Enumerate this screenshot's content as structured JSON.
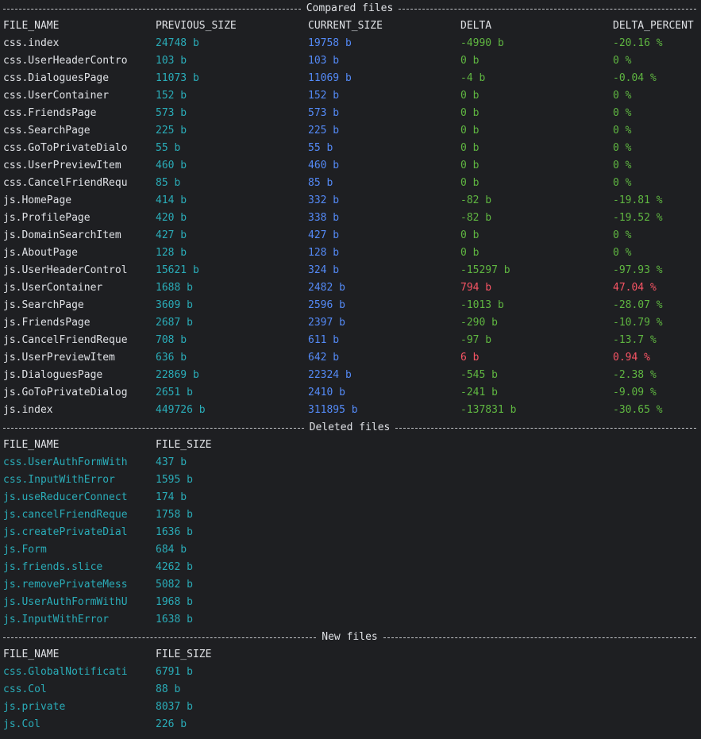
{
  "colors": {
    "background": "#1e1f22",
    "foreground": "#dfe1e5",
    "cyan": "#2aacb8",
    "blue": "#548af7",
    "green": "#5fb641",
    "red": "#f75464"
  },
  "compared": {
    "title": "Compared files",
    "headers": [
      "FILE_NAME",
      "PREVIOUS_SIZE",
      "CURRENT_SIZE",
      "DELTA",
      "DELTA_PERCENT"
    ],
    "rows": [
      {
        "name": "css.index",
        "prev": "24748 b",
        "curr": "19758 b",
        "delta": "-4990 b",
        "pct": "-20.16 %",
        "state": "green"
      },
      {
        "name": "css.UserHeaderContro",
        "prev": "103 b",
        "curr": "103 b",
        "delta": "0 b",
        "pct": "0 %",
        "state": "green"
      },
      {
        "name": "css.DialoguesPage",
        "prev": "11073 b",
        "curr": "11069 b",
        "delta": "-4 b",
        "pct": "-0.04 %",
        "state": "green"
      },
      {
        "name": "css.UserContainer",
        "prev": "152 b",
        "curr": "152 b",
        "delta": "0 b",
        "pct": "0 %",
        "state": "green"
      },
      {
        "name": "css.FriendsPage",
        "prev": "573 b",
        "curr": "573 b",
        "delta": "0 b",
        "pct": "0 %",
        "state": "green"
      },
      {
        "name": "css.SearchPage",
        "prev": "225 b",
        "curr": "225 b",
        "delta": "0 b",
        "pct": "0 %",
        "state": "green"
      },
      {
        "name": "css.GoToPrivateDialo",
        "prev": "55 b",
        "curr": "55 b",
        "delta": "0 b",
        "pct": "0 %",
        "state": "green"
      },
      {
        "name": "css.UserPreviewItem",
        "prev": "460 b",
        "curr": "460 b",
        "delta": "0 b",
        "pct": "0 %",
        "state": "green"
      },
      {
        "name": "css.CancelFriendRequ",
        "prev": "85 b",
        "curr": "85 b",
        "delta": "0 b",
        "pct": "0 %",
        "state": "green"
      },
      {
        "name": "js.HomePage",
        "prev": "414 b",
        "curr": "332 b",
        "delta": "-82 b",
        "pct": "-19.81 %",
        "state": "green"
      },
      {
        "name": "js.ProfilePage",
        "prev": "420 b",
        "curr": "338 b",
        "delta": "-82 b",
        "pct": "-19.52 %",
        "state": "green"
      },
      {
        "name": "js.DomainSearchItem",
        "prev": "427 b",
        "curr": "427 b",
        "delta": "0 b",
        "pct": "0 %",
        "state": "green"
      },
      {
        "name": "js.AboutPage",
        "prev": "128 b",
        "curr": "128 b",
        "delta": "0 b",
        "pct": "0 %",
        "state": "green"
      },
      {
        "name": "js.UserHeaderControl",
        "prev": "15621 b",
        "curr": "324 b",
        "delta": "-15297 b",
        "pct": "-97.93 %",
        "state": "green"
      },
      {
        "name": "js.UserContainer",
        "prev": "1688 b",
        "curr": "2482 b",
        "delta": "794 b",
        "pct": "47.04 %",
        "state": "red"
      },
      {
        "name": "js.SearchPage",
        "prev": "3609 b",
        "curr": "2596 b",
        "delta": "-1013 b",
        "pct": "-28.07 %",
        "state": "green"
      },
      {
        "name": "js.FriendsPage",
        "prev": "2687 b",
        "curr": "2397 b",
        "delta": "-290 b",
        "pct": "-10.79 %",
        "state": "green"
      },
      {
        "name": "js.CancelFriendReque",
        "prev": "708 b",
        "curr": "611 b",
        "delta": "-97 b",
        "pct": "-13.7 %",
        "state": "green"
      },
      {
        "name": "js.UserPreviewItem",
        "prev": "636 b",
        "curr": "642 b",
        "delta": "6 b",
        "pct": "0.94 %",
        "state": "red"
      },
      {
        "name": "js.DialoguesPage",
        "prev": "22869 b",
        "curr": "22324 b",
        "delta": "-545 b",
        "pct": "-2.38 %",
        "state": "green"
      },
      {
        "name": "js.GoToPrivateDialog",
        "prev": "2651 b",
        "curr": "2410 b",
        "delta": "-241 b",
        "pct": "-9.09 %",
        "state": "green"
      },
      {
        "name": "js.index",
        "prev": "449726 b",
        "curr": "311895 b",
        "delta": "-137831 b",
        "pct": "-30.65 %",
        "state": "green"
      }
    ]
  },
  "deleted": {
    "title": "Deleted files",
    "headers": [
      "FILE_NAME",
      "FILE_SIZE"
    ],
    "rows": [
      {
        "name": "css.UserAuthFormWith",
        "size": "437 b"
      },
      {
        "name": "css.InputWithError",
        "size": "1595 b"
      },
      {
        "name": "js.useReducerConnect",
        "size": "174 b"
      },
      {
        "name": "js.cancelFriendReque",
        "size": "1758 b"
      },
      {
        "name": "js.createPrivateDial",
        "size": "1636 b"
      },
      {
        "name": "js.Form",
        "size": "684 b"
      },
      {
        "name": "js.friends.slice",
        "size": "4262 b"
      },
      {
        "name": "js.removePrivateMess",
        "size": "5082 b"
      },
      {
        "name": "js.UserAuthFormWithU",
        "size": "1968 b"
      },
      {
        "name": "js.InputWithError",
        "size": "1638 b"
      }
    ]
  },
  "added": {
    "title": "New files",
    "headers": [
      "FILE_NAME",
      "FILE_SIZE"
    ],
    "rows": [
      {
        "name": "css.GlobalNotificati",
        "size": "6791 b"
      },
      {
        "name": "css.Col",
        "size": "88 b"
      },
      {
        "name": "js.private",
        "size": "8037 b"
      },
      {
        "name": "js.Col",
        "size": "226 b"
      }
    ]
  }
}
